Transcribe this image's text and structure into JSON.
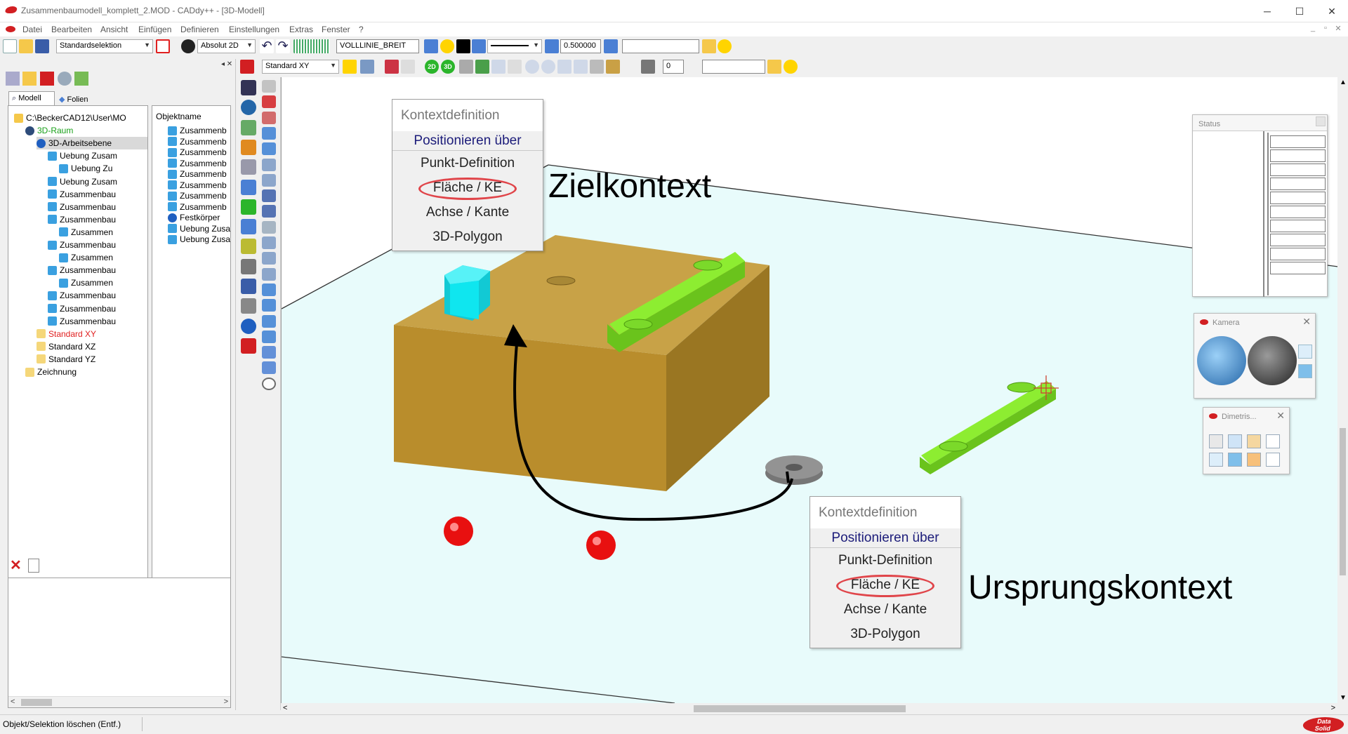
{
  "window": {
    "title": "Zusammenbaumodell_komplett_2.MOD  -  CADdy++ - [3D-Modell]",
    "minimize": "─",
    "maximize": "☐",
    "close": "✕"
  },
  "menu": [
    "Datei",
    "Bearbeiten",
    "Ansicht",
    "Einfügen",
    "Definieren",
    "Einstellungen",
    "Extras",
    "Fenster",
    "?"
  ],
  "mdi_controls": [
    "_",
    "▫",
    "✕"
  ],
  "toolbar1": {
    "selection_mode": "Standardselektion",
    "coord_mode": "Absolut 2D",
    "linetype": "VOLLLINIE_BREIT",
    "line_width": "0.500000",
    "layer_field": ""
  },
  "toolbar2": {
    "view_plane": "Standard XY",
    "view_2d": "2D",
    "view_3d": "3D",
    "step_value": "0",
    "extra_field": ""
  },
  "left_panel": {
    "tabs": [
      "Modell",
      "Folien"
    ],
    "tree": [
      {
        "label": "C:\\BeckerCAD12\\User\\MO",
        "color": "#000",
        "icon": "folder-open",
        "indent": 0
      },
      {
        "label": "3D-Raum",
        "color": "#18a018",
        "icon": "globe",
        "indent": 1
      },
      {
        "label": "3D-Arbeitsebene",
        "color": "#000",
        "icon": "sphere",
        "indent": 2,
        "selected": true
      },
      {
        "label": "Uebung Zusam",
        "color": "#000",
        "icon": "part",
        "indent": 3
      },
      {
        "label": "Uebung Zu",
        "color": "#000",
        "icon": "part",
        "indent": 4
      },
      {
        "label": "Uebung Zusam",
        "color": "#000",
        "icon": "part",
        "indent": 3
      },
      {
        "label": "Zusammenbau",
        "color": "#000",
        "icon": "part",
        "indent": 3
      },
      {
        "label": "Zusammenbau",
        "color": "#000",
        "icon": "part",
        "indent": 3
      },
      {
        "label": "Zusammenbau",
        "color": "#000",
        "icon": "part",
        "indent": 3
      },
      {
        "label": "Zusammen",
        "color": "#000",
        "icon": "part",
        "indent": 4
      },
      {
        "label": "Zusammenbau",
        "color": "#000",
        "icon": "part",
        "indent": 3
      },
      {
        "label": "Zusammen",
        "color": "#000",
        "icon": "part",
        "indent": 4
      },
      {
        "label": "Zusammenbau",
        "color": "#000",
        "icon": "part",
        "indent": 3
      },
      {
        "label": "Zusammen",
        "color": "#000",
        "icon": "part",
        "indent": 4
      },
      {
        "label": "Zusammenbau",
        "color": "#000",
        "icon": "part",
        "indent": 3
      },
      {
        "label": "Zusammenbau",
        "color": "#000",
        "icon": "part",
        "indent": 3
      },
      {
        "label": "Zusammenbau",
        "color": "#000",
        "icon": "part",
        "indent": 3
      },
      {
        "label": "Standard XY",
        "color": "#e02020",
        "icon": "folder",
        "indent": 2
      },
      {
        "label": "Standard XZ",
        "color": "#000",
        "icon": "folder",
        "indent": 2
      },
      {
        "label": "Standard YZ",
        "color": "#000",
        "icon": "folder",
        "indent": 2
      },
      {
        "label": "Zeichnung",
        "color": "#000",
        "icon": "folder",
        "indent": 1
      }
    ],
    "object_header": "Objektname",
    "objects": [
      {
        "label": "Zusammenb",
        "icon": "part"
      },
      {
        "label": "Zusammenb",
        "icon": "part"
      },
      {
        "label": "Zusammenb",
        "icon": "part"
      },
      {
        "label": "Zusammenb",
        "icon": "part"
      },
      {
        "label": "Zusammenb",
        "icon": "part"
      },
      {
        "label": "Zusammenb",
        "icon": "part"
      },
      {
        "label": "Zusammenb",
        "icon": "part"
      },
      {
        "label": "Zusammenb",
        "icon": "part"
      },
      {
        "label": "Festkörper",
        "icon": "sphere"
      },
      {
        "label": "Uebung Zusa",
        "icon": "part"
      },
      {
        "label": "Uebung Zusa",
        "icon": "part"
      }
    ]
  },
  "context_menus": {
    "target": {
      "header": "Kontextdefinition",
      "section": "Positionieren über",
      "items": [
        "Punkt-Definition",
        "Fläche / KE",
        "Achse / Kante",
        "3D-Polygon"
      ],
      "highlighted": "Fläche / KE"
    },
    "origin": {
      "header": "Kontextdefinition",
      "section": "Positionieren über",
      "items": [
        "Punkt-Definition",
        "Fläche / KE",
        "Achse / Kante",
        "3D-Polygon"
      ],
      "highlighted": "Fläche / KE"
    }
  },
  "annotations": {
    "target_label": "Zielkontext",
    "origin_label": "Ursprungskontext"
  },
  "floating_panels": {
    "status": "Status",
    "camera": "Kamera",
    "dimetric": "Dimetris..."
  },
  "statusbar": {
    "message": "Objekt/Selektion löschen (Entf.)",
    "brand_top": "Data",
    "brand_bottom": "Solid"
  },
  "colors": {
    "block": "#c9a045",
    "plate": "#86e82c",
    "nut": "#20dfe8",
    "washer": "#8a8a8a",
    "ball": "#e81010",
    "plane": "#e8fbfb",
    "highlight_ring": "#e0454a",
    "brand_red": "#d21f22"
  }
}
